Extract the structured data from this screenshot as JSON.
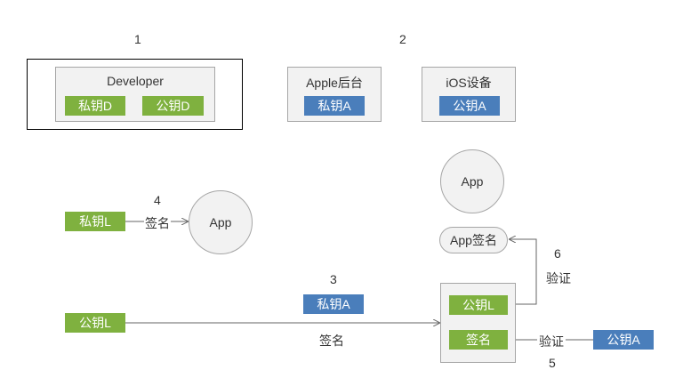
{
  "steps": {
    "s1": "1",
    "s2": "2",
    "s3": "3",
    "s4": "4",
    "s5": "5",
    "s6": "6"
  },
  "developer": {
    "title": "Developer",
    "private_key": "私钥D",
    "public_key": "公钥D"
  },
  "apple": {
    "title": "Apple后台",
    "private_key": "私钥A"
  },
  "ios": {
    "title": "iOS设备",
    "public_key": "公钥A"
  },
  "left": {
    "private_key": "私钥L",
    "public_key": "公钥L",
    "sign_label": "签名",
    "app": "App"
  },
  "middle": {
    "private_key": "私钥A",
    "sign_label": "签名"
  },
  "right": {
    "app": "App",
    "app_signature": "App签名",
    "public_key": "公钥L",
    "signature": "签名",
    "verify_label_6": "验证",
    "verify_label_5": "验证",
    "public_key_a": "公钥A"
  },
  "colors": {
    "green": "#7fb13f",
    "blue": "#4a7ebb",
    "box": "#f2f2f2",
    "border": "#a6a6a6",
    "line": "#666666"
  }
}
